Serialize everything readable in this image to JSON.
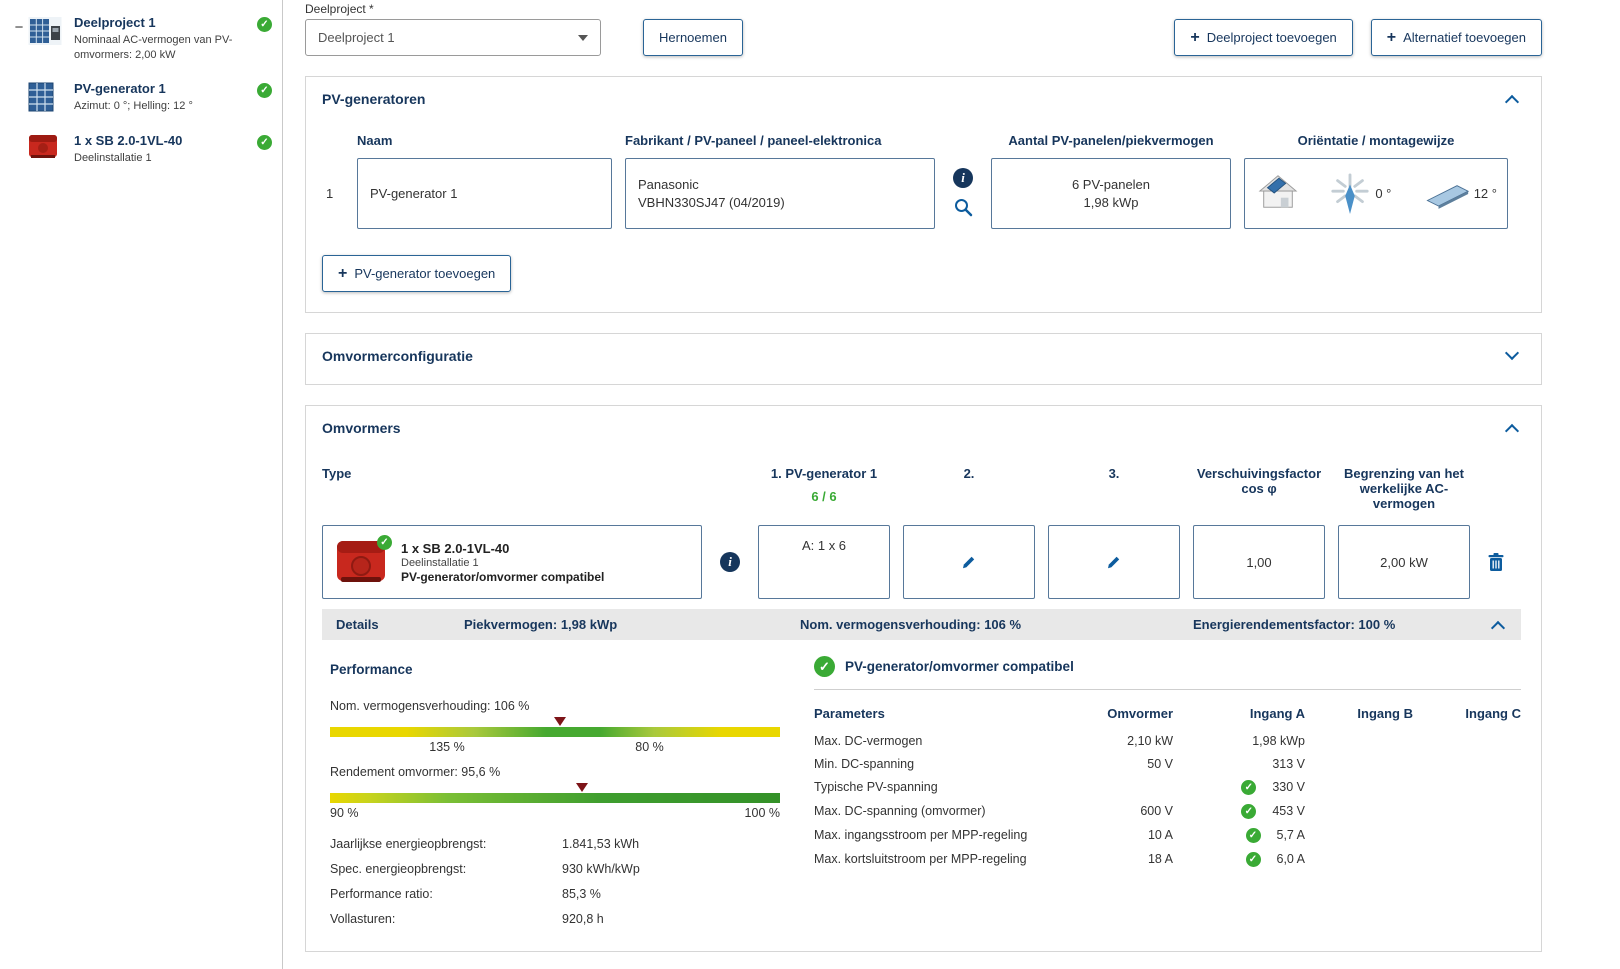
{
  "glyphs": {
    "plus": "+",
    "minus": "−",
    "check": "✓",
    "info": "i"
  },
  "colors": {
    "accent_blue": "#0d5c9e",
    "navy": "#17365c",
    "green": "#3aaa35",
    "marker_red": "#7d1418",
    "box_border": "#57789a"
  },
  "sidebar": {
    "items": [
      {
        "title": "Deelproject 1",
        "subtitle": "Nominaal AC-vermogen van PV-omvormers: 2,00 kW"
      },
      {
        "title": "PV-generator 1",
        "subtitle": "Azimut: 0 °; Helling: 12 °"
      },
      {
        "title": "1 x SB 2.0-1VL-40",
        "subtitle": "Deelinstallatie 1"
      }
    ]
  },
  "topbar": {
    "deelproject_label": "Deelproject *",
    "deelproject_value": "Deelproject 1",
    "rename_button": "Hernoemen",
    "add_deelproject_button": "Deelproject toevoegen",
    "add_alternatief_button": "Alternatief toevoegen"
  },
  "pv_generatoren": {
    "title": "PV-generatoren",
    "col_naam": "Naam",
    "col_fabrikant": "Fabrikant / PV-paneel / paneel-elektronica",
    "col_aantal": "Aantal PV-panelen/piekvermogen",
    "col_orientatie": "Oriëntatie / montagewijze",
    "row": {
      "index": "1",
      "name_value": "PV-generator 1",
      "manufacturer": "Panasonic",
      "panel_model": "VBHN330SJ47 (04/2019)",
      "panel_count": "6 PV-panelen",
      "peak_power": "1,98 kWp",
      "azimuth": "0 °",
      "tilt": "12 °"
    },
    "add_button": "PV-generator toevoegen"
  },
  "omvormerconfiguratie": {
    "title": "Omvormerconfiguratie"
  },
  "omvormers": {
    "title": "Omvormers",
    "col_type": "Type",
    "col_gen1": "1. PV-generator 1",
    "col_gen1_count": "6 / 6",
    "col_2": "2.",
    "col_3": "3.",
    "col_cos": "Verschuivingsfactor cos φ",
    "col_limit": "Begrenzing van het werkelijke AC-vermogen",
    "row": {
      "type_title": "1 x SB 2.0-1VL-40",
      "type_subtitle": "Deelinstallatie 1",
      "type_status": "PV-generator/omvormer compatibel",
      "gen1_assignment": "A: 1 x 6",
      "cos_value": "1,00",
      "limit_value": "2,00 kW"
    },
    "details_bar": {
      "label": "Details",
      "piekvermogen": "Piekvermogen: 1,98 kWp",
      "verhouding": "Nom. vermogensverhouding: 106 %",
      "energierendement": "Energierendementsfactor: 100 %"
    }
  },
  "performance": {
    "title": "Performance",
    "bar1_label": "Nom. vermogensverhouding: 106 %",
    "bar1_tick_left": "135 %",
    "bar1_tick_right": "80 %",
    "bar2_label": "Rendement omvormer: 95,6 %",
    "bar2_tick_left": "90 %",
    "bar2_tick_right": "100 %",
    "stats": [
      {
        "label": "Jaarlijkse energieopbrengst:",
        "value": "1.841,53 kWh"
      },
      {
        "label": "Spec. energieopbrengst:",
        "value": "930 kWh/kWp"
      },
      {
        "label": "Performance ratio:",
        "value": "85,3 %"
      },
      {
        "label": "Vollasturen:",
        "value": "920,8 h"
      }
    ]
  },
  "compat": {
    "title": "PV-generator/omvormer compatibel",
    "col_parameters": "Parameters",
    "col_omvormer": "Omvormer",
    "col_ingang_a": "Ingang A",
    "col_ingang_b": "Ingang B",
    "col_ingang_c": "Ingang C",
    "rows": [
      {
        "label": "Max. DC-vermogen",
        "omvormer": "2,10 kW",
        "ingang_a": "1,98 kWp"
      },
      {
        "label": "Min. DC-spanning",
        "omvormer": "50 V",
        "ingang_a": "313 V"
      },
      {
        "label": "Typische PV-spanning",
        "omvormer": "",
        "ingang_a": "330 V"
      },
      {
        "label": "Max. DC-spanning (omvormer)",
        "omvormer": "600 V",
        "ingang_a": "453 V"
      },
      {
        "label": "Max. ingangsstroom per MPP-regeling",
        "omvormer": "10 A",
        "ingang_a": "5,7 A"
      },
      {
        "label": "Max. kortsluitstroom per MPP-regeling",
        "omvormer": "18 A",
        "ingang_a": "6,0 A"
      }
    ]
  }
}
